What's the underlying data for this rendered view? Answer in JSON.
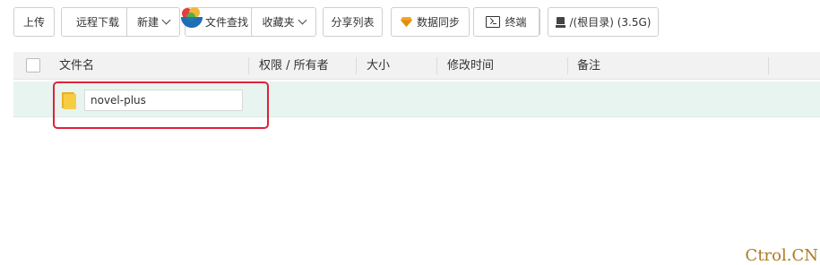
{
  "toolbar": {
    "upload": "上传",
    "remote_download": "远程下载",
    "new": "新建",
    "file_search": "文件查找",
    "favorites": "收藏夹",
    "share_list": "分享列表",
    "data_sync": "数据同步",
    "terminal": "终端",
    "path": "/(根目录) (3.5G)"
  },
  "table": {
    "headers": {
      "filename": "文件名",
      "permission_owner": "权限 / 所有者",
      "size": "大小",
      "modified": "修改时间",
      "remark": "备注"
    },
    "rows": [
      {
        "name_input_value": "novel-plus"
      }
    ]
  },
  "watermark": "Ctrol.CN",
  "colors": {
    "row_selected_bg": "#e8f4f0",
    "highlight_border": "#e0203a",
    "gem": "#f5a623",
    "folder": "#f4c430",
    "watermark": "#b07a22"
  },
  "icons": [
    "gem-icon",
    "terminal-icon",
    "disk-icon",
    "folder-icon",
    "chevron-down-icon",
    "app-logo-icon"
  ]
}
